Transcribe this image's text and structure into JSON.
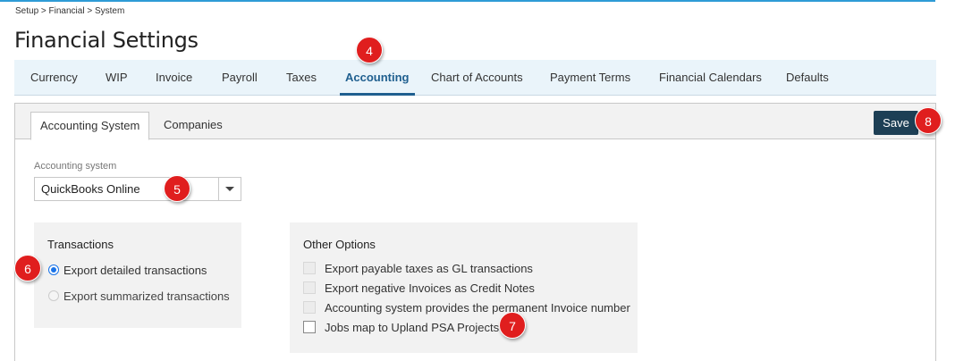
{
  "breadcrumb": "Setup > Financial > System",
  "page_title": "Financial Settings",
  "tabs": [
    {
      "label": "Currency"
    },
    {
      "label": "WIP"
    },
    {
      "label": "Invoice"
    },
    {
      "label": "Payroll"
    },
    {
      "label": "Taxes"
    },
    {
      "label": "Accounting",
      "active": true
    },
    {
      "label": "Chart of Accounts"
    },
    {
      "label": "Payment Terms"
    },
    {
      "label": "Financial Calendars"
    },
    {
      "label": "Defaults"
    }
  ],
  "subtabs": [
    {
      "label": "Accounting System",
      "active": true
    },
    {
      "label": "Companies"
    }
  ],
  "save_label": "Save",
  "accounting_system": {
    "label": "Accounting system",
    "value": "QuickBooks Online"
  },
  "transactions": {
    "title": "Transactions",
    "options": [
      {
        "label": "Export detailed transactions",
        "checked": true
      },
      {
        "label": "Export summarized transactions",
        "checked": false,
        "disabled": true
      }
    ]
  },
  "other_options": {
    "title": "Other Options",
    "options": [
      {
        "label": "Export payable taxes as GL transactions",
        "checked": false,
        "disabled": true
      },
      {
        "label": "Export negative Invoices as Credit Notes",
        "checked": false,
        "disabled": true
      },
      {
        "label": "Accounting system provides the permanent Invoice number",
        "checked": false,
        "disabled": true
      },
      {
        "label": "Jobs map to Upland PSA Projects",
        "checked": false,
        "disabled": false
      }
    ]
  },
  "markers": {
    "m4": "4",
    "m5": "5",
    "m6": "6",
    "m7": "7",
    "m8": "8"
  },
  "colors": {
    "accent": "#1f5f8f",
    "save_button": "#1d3f55",
    "marker": "#e01e1e",
    "top_rule": "#2e9bd6"
  }
}
